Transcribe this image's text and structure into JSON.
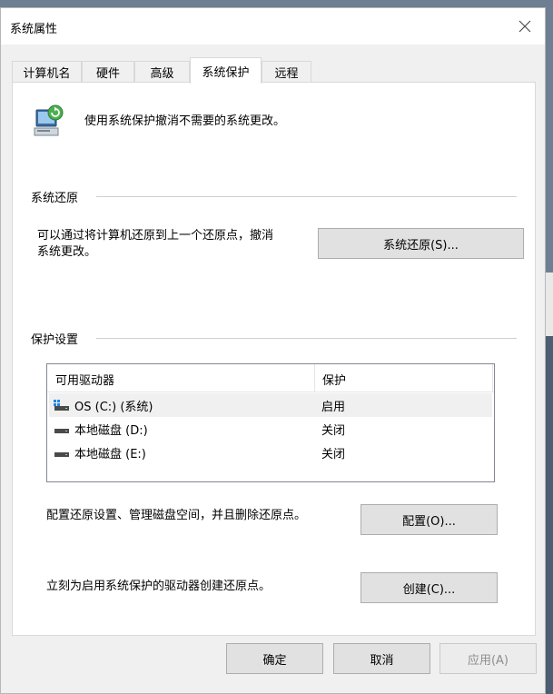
{
  "window": {
    "title": "系统属性"
  },
  "tabs": [
    {
      "label": "计算机名"
    },
    {
      "label": "硬件"
    },
    {
      "label": "高级"
    },
    {
      "label": "系统保护"
    },
    {
      "label": "远程"
    }
  ],
  "active_tab": "系统保护",
  "intro": {
    "text": "使用系统保护撤消不需要的系统更改。"
  },
  "restore_group": {
    "heading": "系统还原",
    "description_line1": "可以通过将计算机还原到上一个还原点，撤消",
    "description_line2": "系统更改。",
    "button_label": "系统还原(S)..."
  },
  "protection_group": {
    "heading": "保护设置",
    "columns": {
      "drive": "可用驱动器",
      "protection": "保护"
    },
    "rows": [
      {
        "name": "OS (C:) (系统)",
        "protection": "启用",
        "icon": "system-drive-icon"
      },
      {
        "name": "本地磁盘 (D:)",
        "protection": "关闭",
        "icon": "disk-drive-icon"
      },
      {
        "name": "本地磁盘 (E:)",
        "protection": "关闭",
        "icon": "disk-drive-icon"
      }
    ],
    "configure_text": "配置还原设置、管理磁盘空间，并且删除还原点。",
    "configure_button": "配置(O)...",
    "create_text": "立刻为启用系统保护的驱动器创建还原点。",
    "create_button": "创建(C)..."
  },
  "footer": {
    "ok": "确定",
    "cancel": "取消",
    "apply": "应用(A)"
  }
}
